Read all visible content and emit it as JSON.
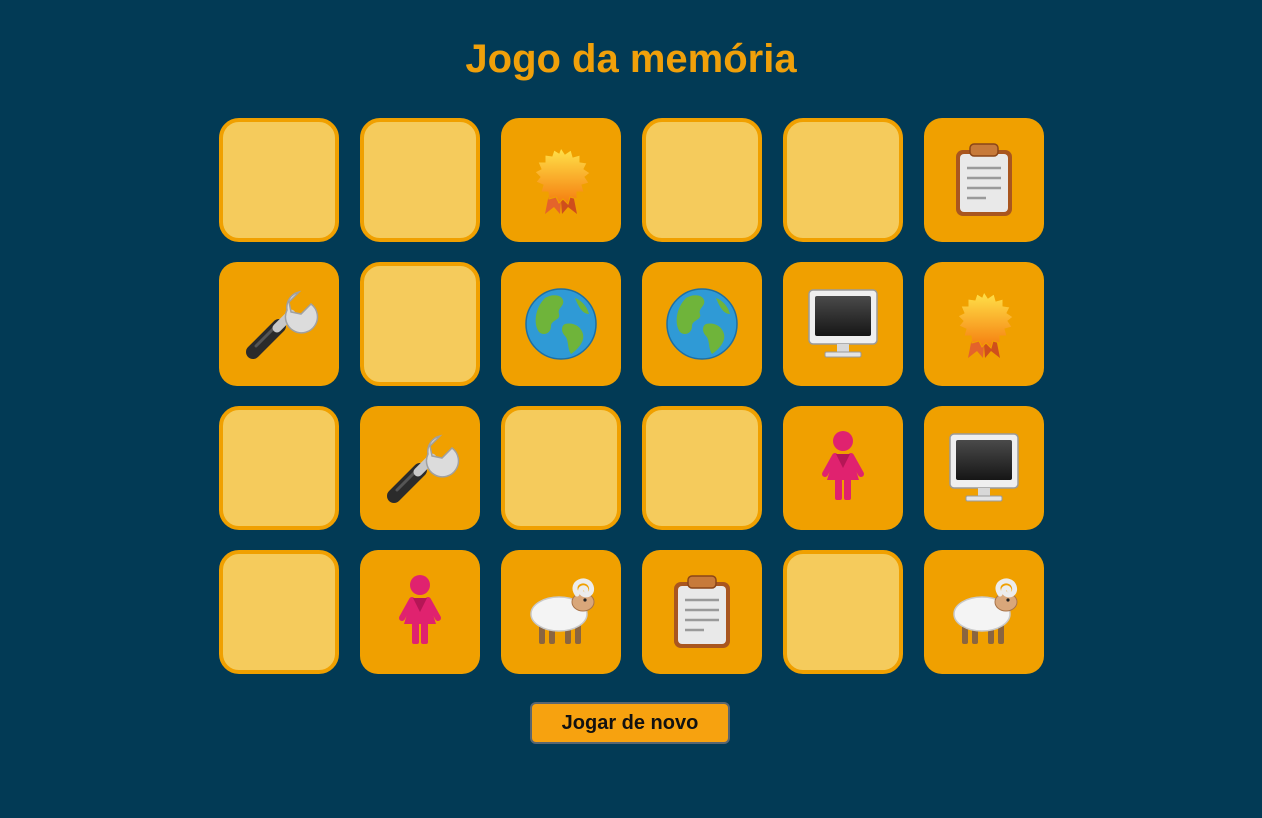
{
  "title": "Jogo da memória",
  "replay_label": "Jogar de novo",
  "colors": {
    "background": "#023a55",
    "card_face": "#f0a000",
    "card_back": "#f5cb5c",
    "title": "#f0a00a",
    "button": "#f7a20f"
  },
  "cards": [
    {
      "state": "hidden",
      "icon": null
    },
    {
      "state": "hidden",
      "icon": null
    },
    {
      "state": "revealed",
      "icon": "rosette-icon"
    },
    {
      "state": "hidden",
      "icon": null
    },
    {
      "state": "hidden",
      "icon": null
    },
    {
      "state": "revealed",
      "icon": "clipboard-icon"
    },
    {
      "state": "revealed",
      "icon": "wrench-icon"
    },
    {
      "state": "hidden",
      "icon": null
    },
    {
      "state": "revealed",
      "icon": "globe-icon"
    },
    {
      "state": "revealed",
      "icon": "globe-icon"
    },
    {
      "state": "revealed",
      "icon": "monitor-icon"
    },
    {
      "state": "revealed",
      "icon": "rosette-icon"
    },
    {
      "state": "hidden",
      "icon": null
    },
    {
      "state": "revealed",
      "icon": "wrench-icon"
    },
    {
      "state": "hidden",
      "icon": null
    },
    {
      "state": "hidden",
      "icon": null
    },
    {
      "state": "revealed",
      "icon": "woman-icon"
    },
    {
      "state": "revealed",
      "icon": "monitor-icon"
    },
    {
      "state": "hidden",
      "icon": null
    },
    {
      "state": "revealed",
      "icon": "woman-icon"
    },
    {
      "state": "revealed",
      "icon": "ram-icon"
    },
    {
      "state": "revealed",
      "icon": "clipboard-icon"
    },
    {
      "state": "hidden",
      "icon": null
    },
    {
      "state": "revealed",
      "icon": "ram-icon"
    }
  ]
}
